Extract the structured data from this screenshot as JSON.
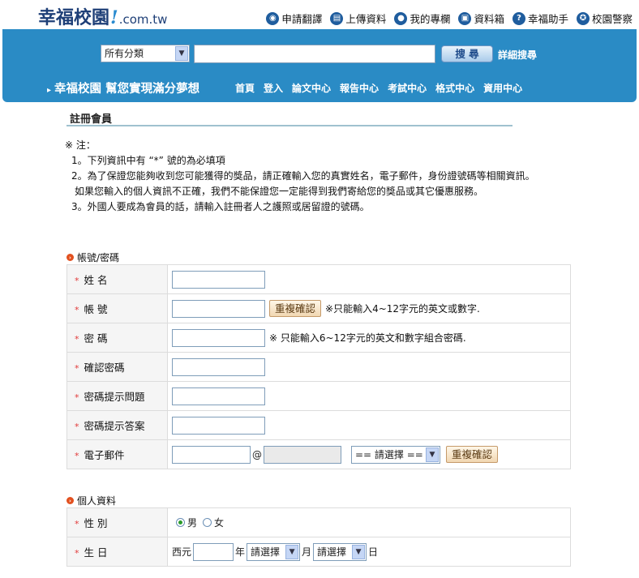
{
  "header": {
    "logo_main": "幸福校園",
    "logo_slash": "!",
    "logo_domain": ".com.tw",
    "links": [
      {
        "label": "申請翻譯",
        "icon": "translate-icon"
      },
      {
        "label": "上傳資料",
        "icon": "upload-icon"
      },
      {
        "label": "我的專欄",
        "icon": "user-icon"
      },
      {
        "label": "資料箱",
        "icon": "box-icon"
      },
      {
        "label": "幸福助手",
        "icon": "help-icon"
      },
      {
        "label": "校園警察",
        "icon": "police-icon"
      }
    ]
  },
  "search": {
    "category": "所有分類",
    "button": "搜 尋",
    "advanced": "詳細搜尋"
  },
  "slogan": "幸福校園 幫您實現滿分夢想",
  "nav": [
    "首頁",
    "登入",
    "論文中心",
    "報告中心",
    "考試中心",
    "格式中心",
    "資用中心"
  ],
  "page_title": "註冊會員",
  "notes": {
    "head": "※ 注：",
    "n1": "1。下列資訊中有 “*” 號的為必填項",
    "n2": "2。為了保證您能夠收到您可能獲得的獎品，請正確輸入您的真實姓名，電子郵件，身份證號碼等相關資訊。",
    "n2b": "如果您輸入的個人資訊不正確，我們不能保證您一定能得到我們寄給您的獎品或其它優惠服務。",
    "n3": "3。外國人要成為會員的話，請輸入註冊者人之護照或居留證的號碼。"
  },
  "account": {
    "heading": "帳號/密碼",
    "required_mark": "*",
    "name_label": "姓 名",
    "account_label": "帳 號",
    "account_check": "重複確認",
    "account_hint": "※只能輸入4~12字元的英文或數字.",
    "password_label": "密 碼",
    "password_hint": "※ 只能輸入6~12字元的英文和數字組合密碼.",
    "confirm_label": "確認密碼",
    "question_label": "密碼提示問題",
    "answer_label": "密碼提示答案",
    "email_label": "電子郵件",
    "email_at": "@",
    "email_select": "== 請選擇 ==",
    "email_check": "重複確認"
  },
  "personal": {
    "heading": "個人資料",
    "gender_label": "性 別",
    "male": "男",
    "female": "女",
    "birthday_label": "生 日",
    "era": "西元",
    "year_unit": "年",
    "month_select": "請選擇",
    "month_unit": "月",
    "day_select": "請選擇",
    "day_unit": "日"
  }
}
